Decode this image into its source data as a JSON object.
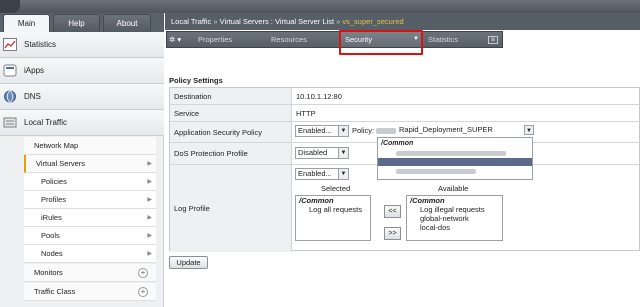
{
  "nav": {
    "tabs": [
      "Main",
      "Help",
      "About"
    ],
    "sections": [
      {
        "label": "Statistics",
        "icon": "statistics-icon"
      },
      {
        "label": "iApps",
        "icon": "iapps-icon"
      },
      {
        "label": "DNS",
        "icon": "dns-icon"
      },
      {
        "label": "Local Traffic",
        "icon": "local-traffic-icon"
      }
    ],
    "local_traffic_items": [
      "Network Map",
      "Virtual Servers",
      "Policies",
      "Profiles",
      "iRules",
      "Pools",
      "Nodes",
      "Monitors",
      "Traffic Class"
    ]
  },
  "breadcrumb": {
    "root": "Local Traffic",
    "sep": "»",
    "middle": "Virtual Servers : Virtual Server List",
    "current": "vs_super_secured"
  },
  "tabs": {
    "gear": "✲ ▾",
    "properties": "Properties",
    "resources": "Resources",
    "security": "Security",
    "statistics": "Statistics",
    "ext": "⊠"
  },
  "policy_settings": {
    "title": "Policy Settings",
    "rows": {
      "destination": {
        "label": "Destination",
        "value": "10.10.1.12:80"
      },
      "service": {
        "label": "Service",
        "value": "HTTP"
      },
      "asp": {
        "label": "Application Security Policy",
        "state": "Enabled...",
        "policy_label": "Policy:",
        "policy_value": "Rapid_Deployment_SUPER"
      },
      "dos": {
        "label": "DoS Protection Profile",
        "state": "Disabled"
      },
      "log": {
        "label": "Log Profile",
        "state": "Enabled...",
        "selected_label": "Selected",
        "available_label": "Available",
        "selected_items": [
          "/Common",
          "Log all requests"
        ],
        "available_items": [
          "/Common",
          "Log illegal requests",
          "global-network",
          "local-dos"
        ],
        "move_left": "<<",
        "move_right": ">>"
      }
    },
    "dropdown_header": "/Common"
  },
  "update_button": "Update"
}
